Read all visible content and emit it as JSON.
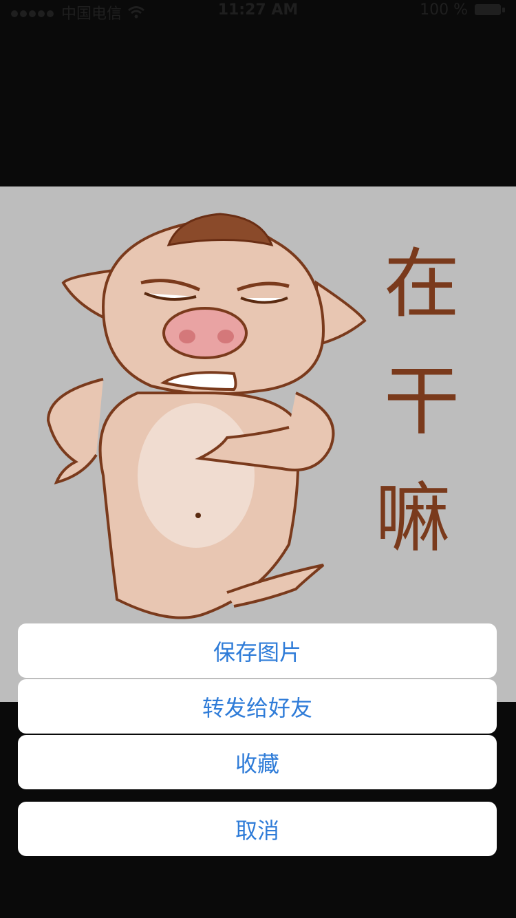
{
  "status_bar": {
    "carrier": "中国电信",
    "time": "11:27 AM",
    "battery_percent": "100 %",
    "signal_icon": "signal-dots-icon",
    "wifi_icon": "wifi-icon",
    "battery_icon": "battery-icon"
  },
  "image": {
    "caption": "在干嘛",
    "subject_icon": "angry-pig-cartoon",
    "background_color": "#bdbdbd"
  },
  "action_sheet": {
    "save_label": "保存图片",
    "forward_label": "转发给好友",
    "favorite_label": "收藏",
    "cancel_label": "取消",
    "accent_color": "#2f7cd8"
  }
}
